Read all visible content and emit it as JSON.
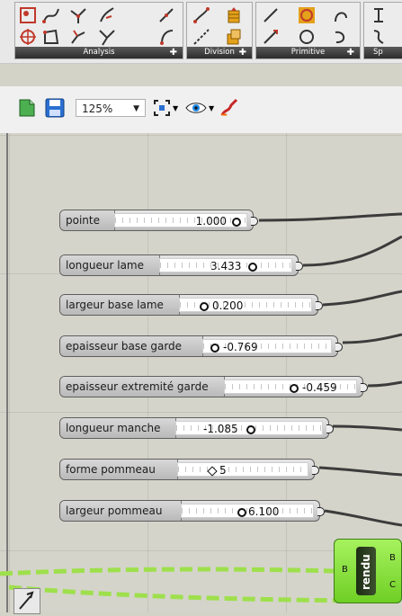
{
  "ribbon": {
    "groups": [
      {
        "label": "Analysis"
      },
      {
        "label": "Division"
      },
      {
        "label": "Primitive"
      },
      {
        "label": "Sp"
      }
    ]
  },
  "toolbar": {
    "zoom": "125%"
  },
  "sliders": [
    {
      "label": "pointe",
      "value": "1.000",
      "knob": 0.95
    },
    {
      "label": "longueur lame",
      "value": "3.433",
      "knob": 0.55
    },
    {
      "label": "largeur base lame",
      "value": "0.200",
      "knob": 0.05
    },
    {
      "label": "epaisseur base garde",
      "value": "-0.769",
      "knob": 0.02
    },
    {
      "label": "epaisseur extremité garde",
      "value": "-0.459",
      "knob": 0.55
    },
    {
      "label": "longueur manche",
      "value": "-1.085",
      "knob": 0.52
    },
    {
      "label": "forme pommeau",
      "value": "5",
      "knob": 0.35
    },
    {
      "label": "largeur pommeau",
      "value": "6.100",
      "knob": 0.45
    }
  ],
  "node": {
    "title": "rendu",
    "in_port": "B",
    "out_ports": [
      "B",
      "C"
    ]
  },
  "colors": {
    "canvas": "#d4d4ca",
    "node_green": "#8be23e",
    "wire_green": "#9ee04c"
  }
}
